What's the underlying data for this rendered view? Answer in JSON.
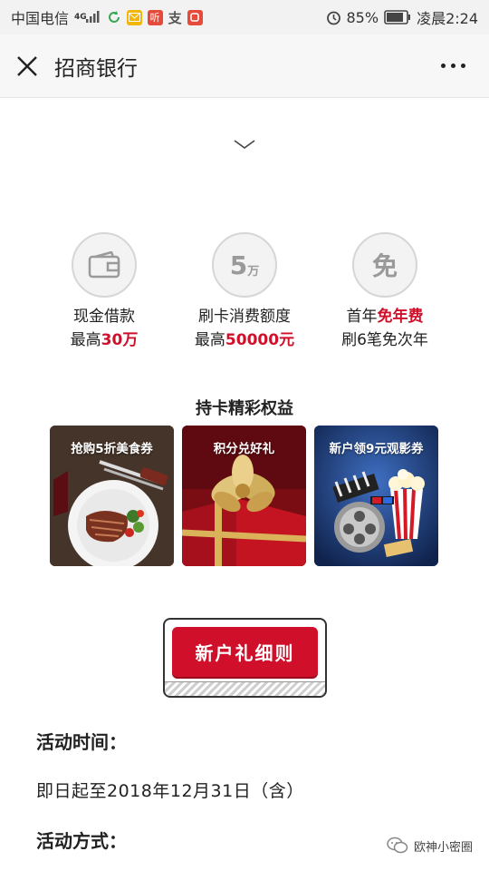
{
  "status_bar": {
    "carrier": "中国电信",
    "network": "4G",
    "battery": "85%",
    "time": "凌晨2:24",
    "app_icons": [
      "refresh-icon",
      "mail-icon",
      "listen-app-icon",
      "alipay-icon",
      "red-app-icon"
    ],
    "listen_glyph": "听",
    "alipay_glyph": "支"
  },
  "nav": {
    "title": "招商银行"
  },
  "features": [
    {
      "glyph": "",
      "icon": "wallet-icon",
      "line1": "现金借款",
      "line2_pre": "最高",
      "line2_hl": "30万",
      "line2_post": ""
    },
    {
      "glyph": "5",
      "glyph_sub": "万",
      "icon": "five-wan-icon",
      "line1": "刷卡消费额度",
      "line2_pre": "最高",
      "line2_hl": "50000元",
      "line2_post": ""
    },
    {
      "glyph": "免",
      "icon": "mian-icon",
      "line1_pre": "首年",
      "line1_hl": "免年费",
      "line2": "刷6笔免次年"
    }
  ],
  "section_title": "持卡精彩权益",
  "tiles": [
    {
      "label": "抢购5折美食券"
    },
    {
      "label": "积分兑好礼"
    },
    {
      "label": "新户领9元观影券"
    }
  ],
  "button_label": "新户礼细则",
  "activity_time_label": "活动时间：",
  "activity_time_value": "即日起至2018年12月31日（含）",
  "activity_method_label": "活动方式：",
  "watermark": "欧神小密圈",
  "colors": {
    "accent": "#d0102b",
    "text": "#222222",
    "bar": "#f2f2f2"
  }
}
